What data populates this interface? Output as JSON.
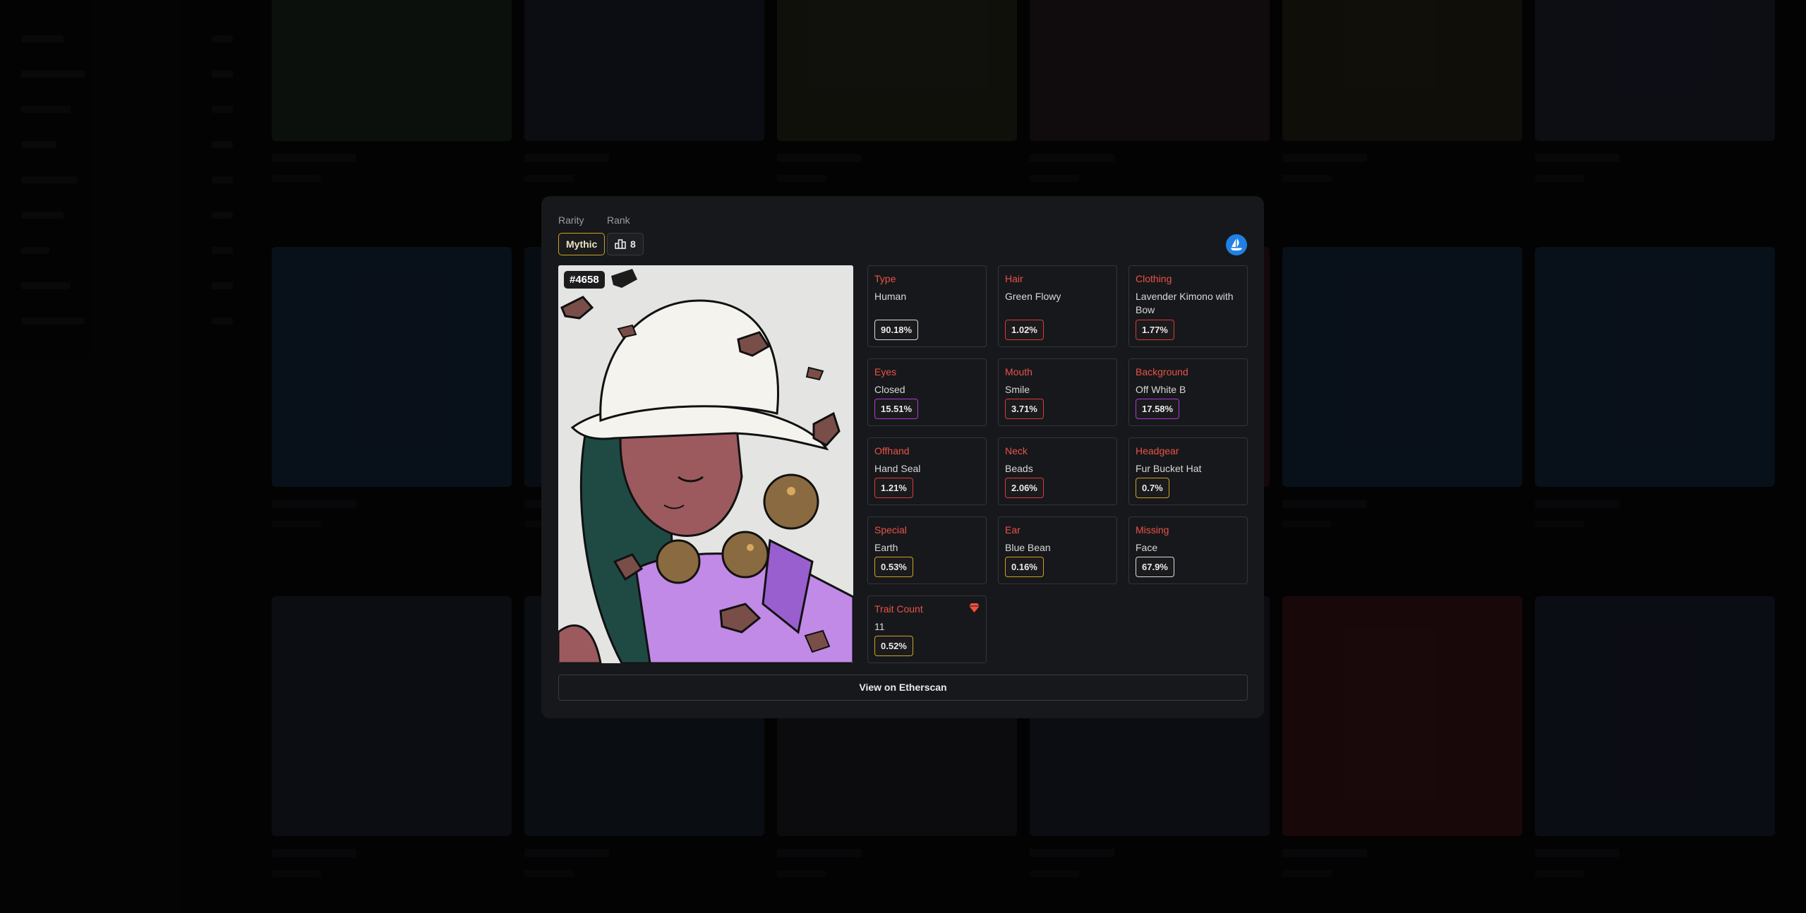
{
  "modal": {
    "rarity_label": "Rarity",
    "rank_label": "Rank",
    "rarity_value": "Mythic",
    "rank_value": "8",
    "rank_icon": "podium-icon",
    "marketplace_icon": "opensea-icon",
    "token_id": "#4658",
    "etherscan_label": "View on Etherscan",
    "traits": [
      {
        "name": "Type",
        "value": "Human",
        "percent": "90.18%",
        "tier_color": "#d9d9d9"
      },
      {
        "name": "Hair",
        "value": "Green Flowy",
        "percent": "1.02%",
        "tier_color": "#d83a3a"
      },
      {
        "name": "Clothing",
        "value": "Lavender Kimono with Bow",
        "percent": "1.77%",
        "tier_color": "#d83a3a"
      },
      {
        "name": "Eyes",
        "value": "Closed",
        "percent": "15.51%",
        "tier_color": "#b03ad8"
      },
      {
        "name": "Mouth",
        "value": "Smile",
        "percent": "3.71%",
        "tier_color": "#d83a3a"
      },
      {
        "name": "Background",
        "value": "Off White B",
        "percent": "17.58%",
        "tier_color": "#b03ad8"
      },
      {
        "name": "Offhand",
        "value": "Hand Seal",
        "percent": "1.21%",
        "tier_color": "#d83a3a"
      },
      {
        "name": "Neck",
        "value": "Beads",
        "percent": "2.06%",
        "tier_color": "#d83a3a"
      },
      {
        "name": "Headgear",
        "value": "Fur Bucket Hat",
        "percent": "0.7%",
        "tier_color": "#c9a227"
      },
      {
        "name": "Special",
        "value": "Earth",
        "percent": "0.53%",
        "tier_color": "#c9a227"
      },
      {
        "name": "Ear",
        "value": "Blue Bean",
        "percent": "0.16%",
        "tier_color": "#c9a227"
      },
      {
        "name": "Missing",
        "value": "Face",
        "percent": "67.9%",
        "tier_color": "#d9d9d9"
      },
      {
        "name": "Trait Count",
        "value": "11",
        "percent": "0.52%",
        "tier_color": "#c9a227"
      }
    ]
  },
  "colors": {
    "accent_red": "#e8524a",
    "mythic_gold": "#c9a227",
    "opensea_blue": "#2081e2",
    "gem_color": "#f0513e"
  }
}
